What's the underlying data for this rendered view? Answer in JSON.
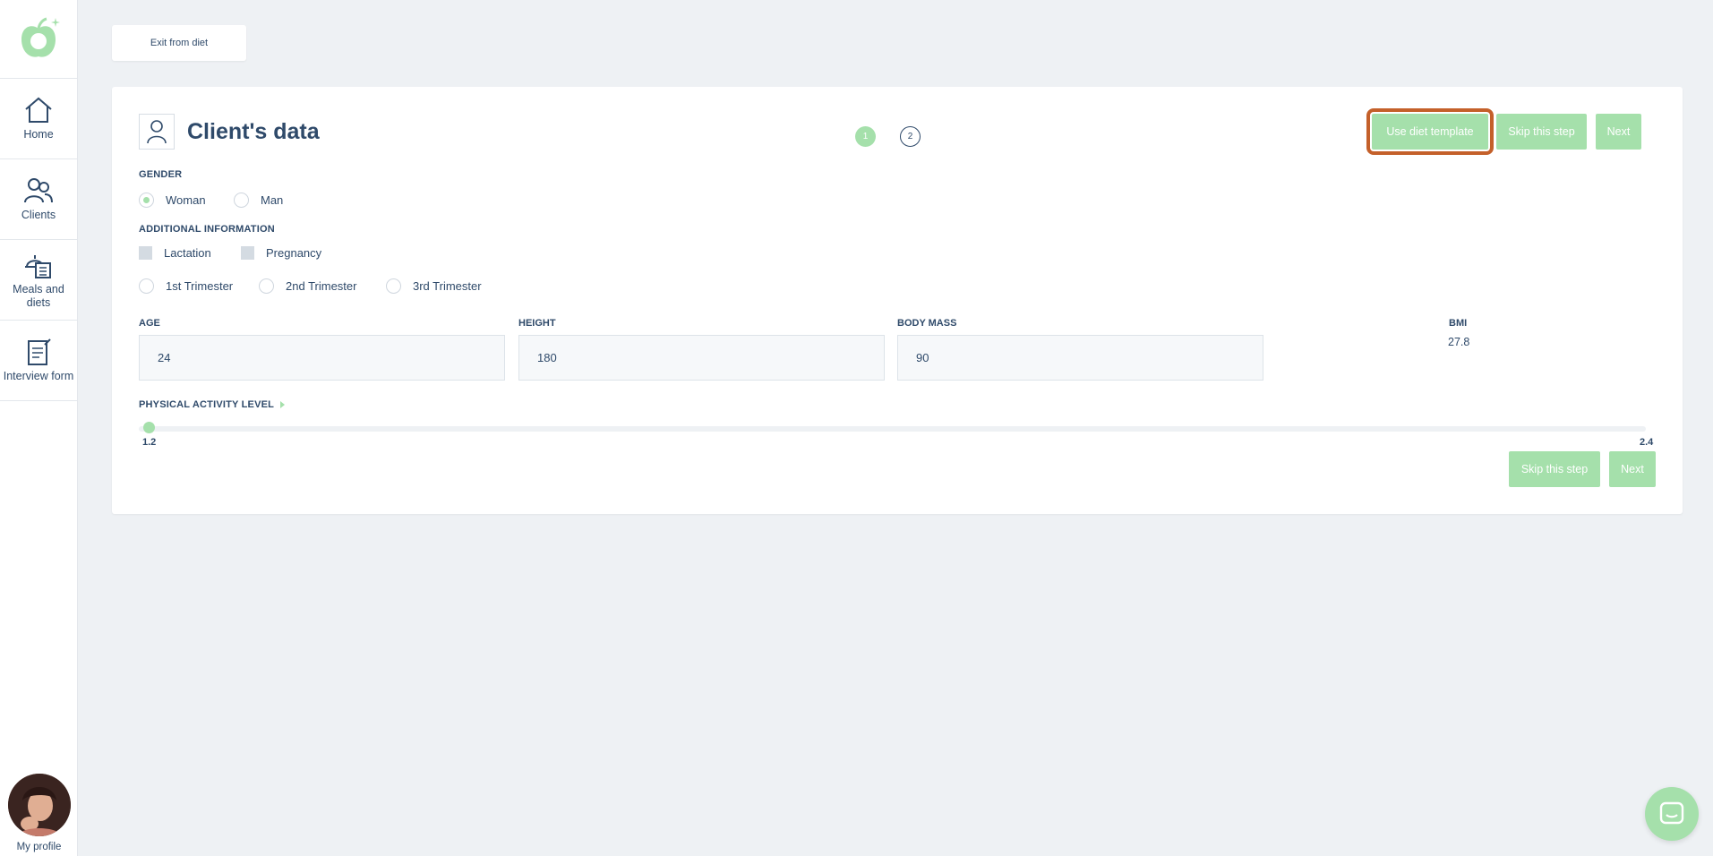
{
  "sidebar": {
    "items": [
      {
        "label": "Home",
        "icon": "home-icon"
      },
      {
        "label": "Clients",
        "icon": "users-icon"
      },
      {
        "label": "Meals and diets",
        "icon": "meal-icon"
      },
      {
        "label": "Interview form",
        "icon": "form-icon"
      }
    ],
    "profile_label": "My profile"
  },
  "header": {
    "exit_label": "Exit from diet"
  },
  "card": {
    "title": "Client's data",
    "steps": [
      "1",
      "2"
    ],
    "active_step": 1,
    "buttons": {
      "use_template": "Use diet template",
      "skip": "Skip this step",
      "next": "Next"
    }
  },
  "gender": {
    "label": "GENDER",
    "options": [
      "Woman",
      "Man"
    ],
    "selected": "Woman"
  },
  "additional": {
    "label": "ADDITIONAL INFORMATION",
    "checkboxes": [
      "Lactation",
      "Pregnancy"
    ],
    "trimesters": [
      "1st Trimester",
      "2nd Trimester",
      "3rd Trimester"
    ]
  },
  "fields": {
    "age": {
      "label": "AGE",
      "value": "24"
    },
    "height": {
      "label": "HEIGHT",
      "value": "180"
    },
    "body_mass": {
      "label": "BODY MASS",
      "value": "90"
    },
    "bmi": {
      "label": "BMI",
      "value": "27.8"
    }
  },
  "activity": {
    "label": "PHYSICAL ACTIVITY LEVEL",
    "min": "1.2",
    "max": "2.4",
    "value": 1.2
  },
  "colors": {
    "accent": "#a5e0ab",
    "highlight": "#c4602a",
    "text": "#2f4a6a"
  }
}
